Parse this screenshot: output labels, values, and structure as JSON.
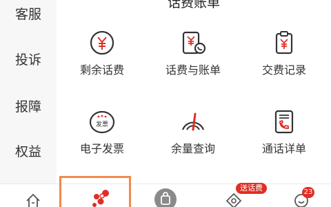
{
  "sidebar": {
    "items": [
      {
        "label": "客服"
      },
      {
        "label": "投诉"
      },
      {
        "label": "报障"
      },
      {
        "label": "权益"
      }
    ]
  },
  "main": {
    "header_partial": "话费账单",
    "tiles": [
      {
        "label": "剩余话费",
        "icon": "yuan-circle-icon"
      },
      {
        "label": "话费与账单",
        "icon": "bill-phone-icon"
      },
      {
        "label": "交费记录",
        "icon": "payment-record-icon"
      },
      {
        "label": "电子发票",
        "icon": "invoice-icon",
        "icon_text": "发票"
      },
      {
        "label": "余量查询",
        "icon": "gauge-icon"
      },
      {
        "label": "通话详单",
        "icon": "call-detail-icon"
      }
    ]
  },
  "tabbar": {
    "badge_text": "送话费",
    "badge_count": "23"
  },
  "colors": {
    "accent_red": "#e02e24",
    "active_outline": "#f08a4b",
    "sidebar_bg": "#f7f7f7",
    "icon_stroke": "#333333"
  }
}
